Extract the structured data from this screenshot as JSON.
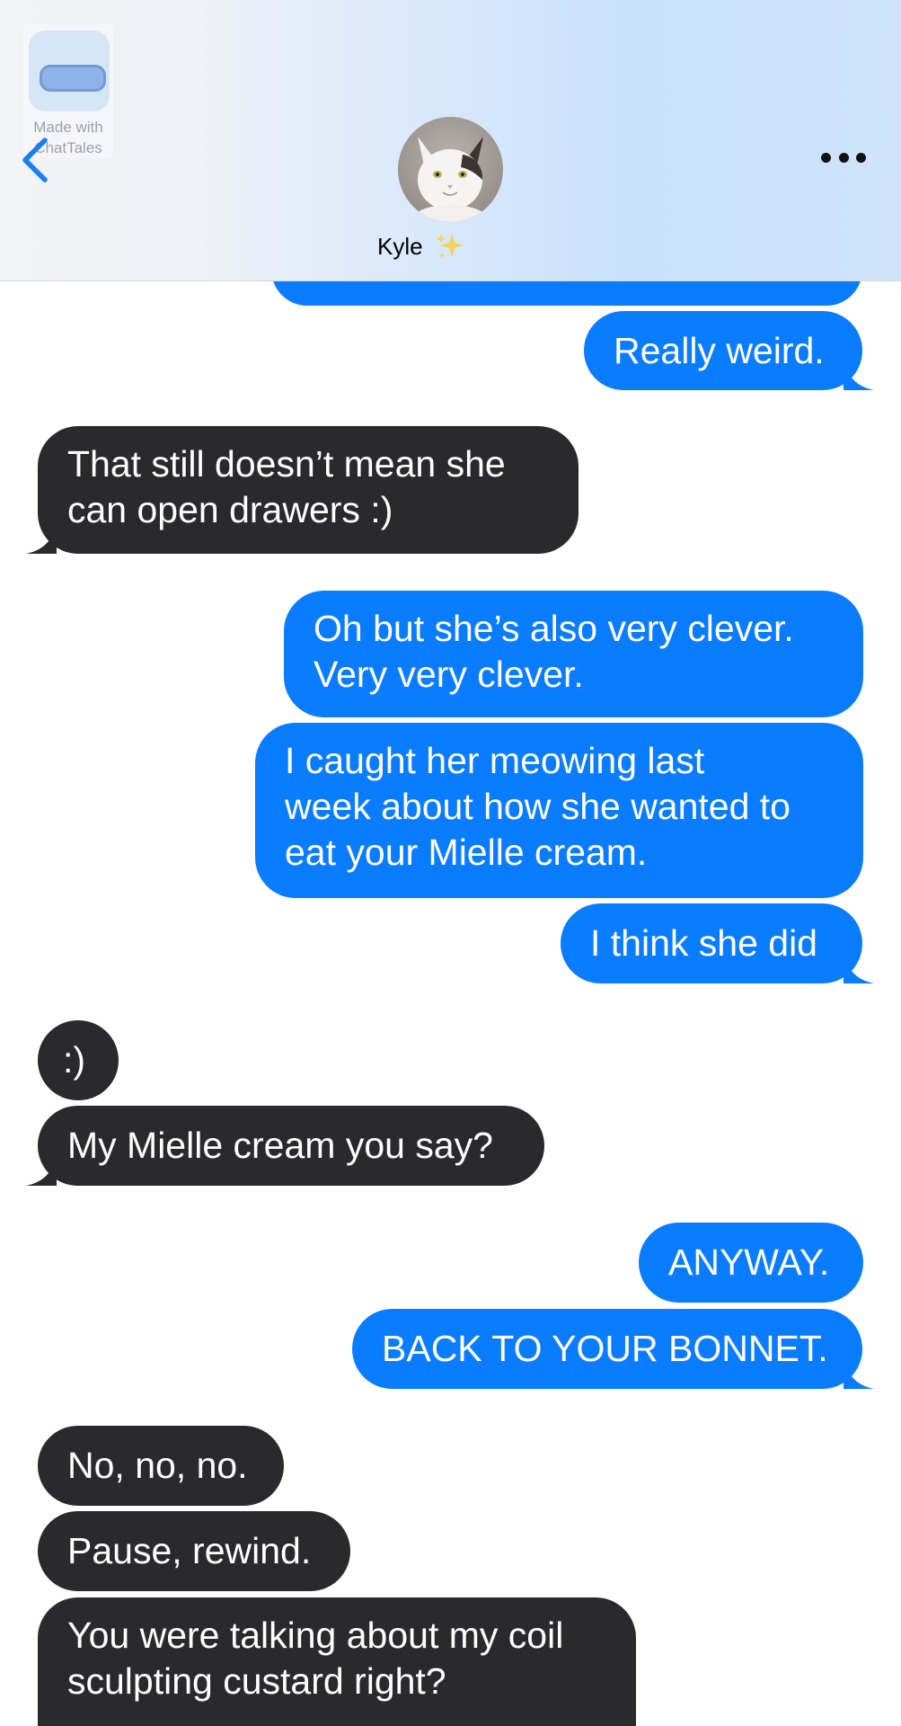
{
  "header": {
    "watermark_line1": "Made with",
    "watermark_line2": "ChatTales",
    "contact_name": "Kyle",
    "contact_emoji": "sparkles-icon",
    "back_icon": "chevron-left-icon",
    "more_icon": "ellipsis-icon"
  },
  "messages": [
    {
      "dir": "out",
      "text": "Really weird."
    },
    {
      "dir": "in",
      "lines": [
        "That still doesn’t mean she",
        "can open drawers :)"
      ]
    },
    {
      "dir": "out",
      "lines": [
        "Oh but she’s also very clever.",
        "Very very clever."
      ]
    },
    {
      "dir": "out",
      "lines": [
        "I caught her meowing last",
        "week about how she wanted to",
        "eat your Mielle cream."
      ]
    },
    {
      "dir": "out",
      "text": "I think she did"
    },
    {
      "dir": "in",
      "text": ":)"
    },
    {
      "dir": "in",
      "text": "My Mielle cream you say?"
    },
    {
      "dir": "out",
      "text": "ANYWAY."
    },
    {
      "dir": "out",
      "text": "BACK TO YOUR BONNET."
    },
    {
      "dir": "in",
      "text": "No, no, no."
    },
    {
      "dir": "in",
      "text": "Pause, rewind."
    },
    {
      "dir": "in",
      "lines": [
        "You were talking about my coil",
        "sculpting custard right?"
      ]
    }
  ],
  "colors": {
    "outgoing_bubble": "#0a7cff",
    "incoming_bubble": "#2a2a2c",
    "link_blue": "#1a7df2"
  }
}
